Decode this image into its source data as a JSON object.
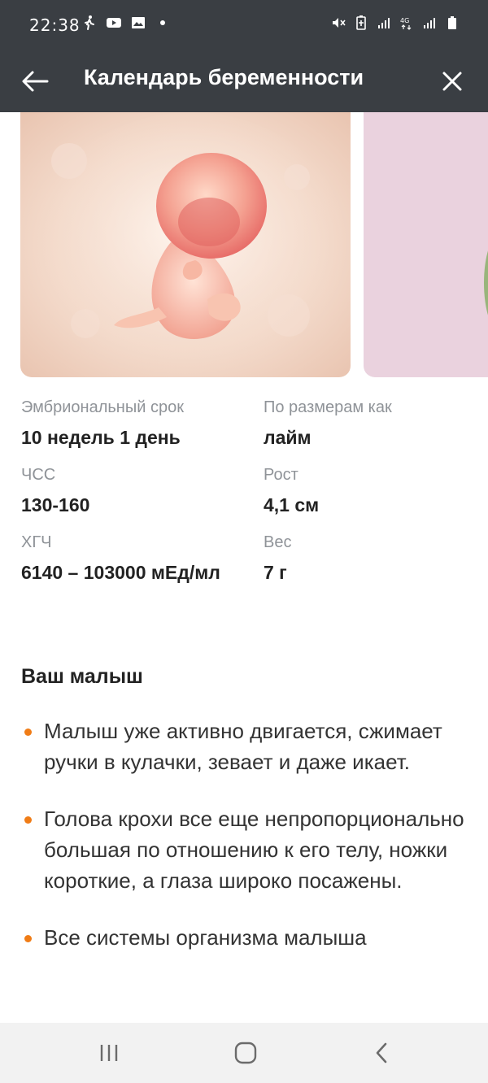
{
  "status_bar": {
    "time": "22:38",
    "left_icons": [
      "walking-icon",
      "youtube-icon",
      "image-icon",
      "dot-icon"
    ],
    "right_icons": [
      "mute-icon",
      "battery-saver-icon",
      "signal-icon",
      "4g-icon",
      "signal-icon",
      "battery-icon"
    ]
  },
  "app_bar": {
    "title": "Календарь беременности",
    "back_icon": "arrow-left-icon",
    "close_icon": "close-icon"
  },
  "carousel": {
    "slides": [
      "embryo-image",
      "fruit-image"
    ]
  },
  "stats": [
    {
      "label": "Эмбриональный срок",
      "value": "10 недель 1 день"
    },
    {
      "label": "По размерам как",
      "value": "лайм"
    },
    {
      "label": "ЧСС",
      "value": "130-160"
    },
    {
      "label": "Рост",
      "value": "4,1 см"
    },
    {
      "label": "ХГЧ",
      "value": "6140 – 103000 мЕд/мл"
    },
    {
      "label": "Вес",
      "value": "7 г"
    }
  ],
  "section": {
    "title": "Ваш малыш",
    "bullets": [
      "Малыш уже активно двигается, сжимает ручки в кулачки, зевает и даже икает.",
      "Голова крохи все еще непропорционально большая по отношению к его телу, ножки короткие, а глаза широко посажены.",
      "Все системы организма малыша"
    ]
  },
  "colors": {
    "bar": "#3a3e43",
    "accent_bullet": "#f07c16",
    "label": "#8f9398",
    "text": "#222222"
  },
  "nav_bar": {
    "buttons": [
      "recents-icon",
      "home-icon",
      "back-icon"
    ]
  }
}
